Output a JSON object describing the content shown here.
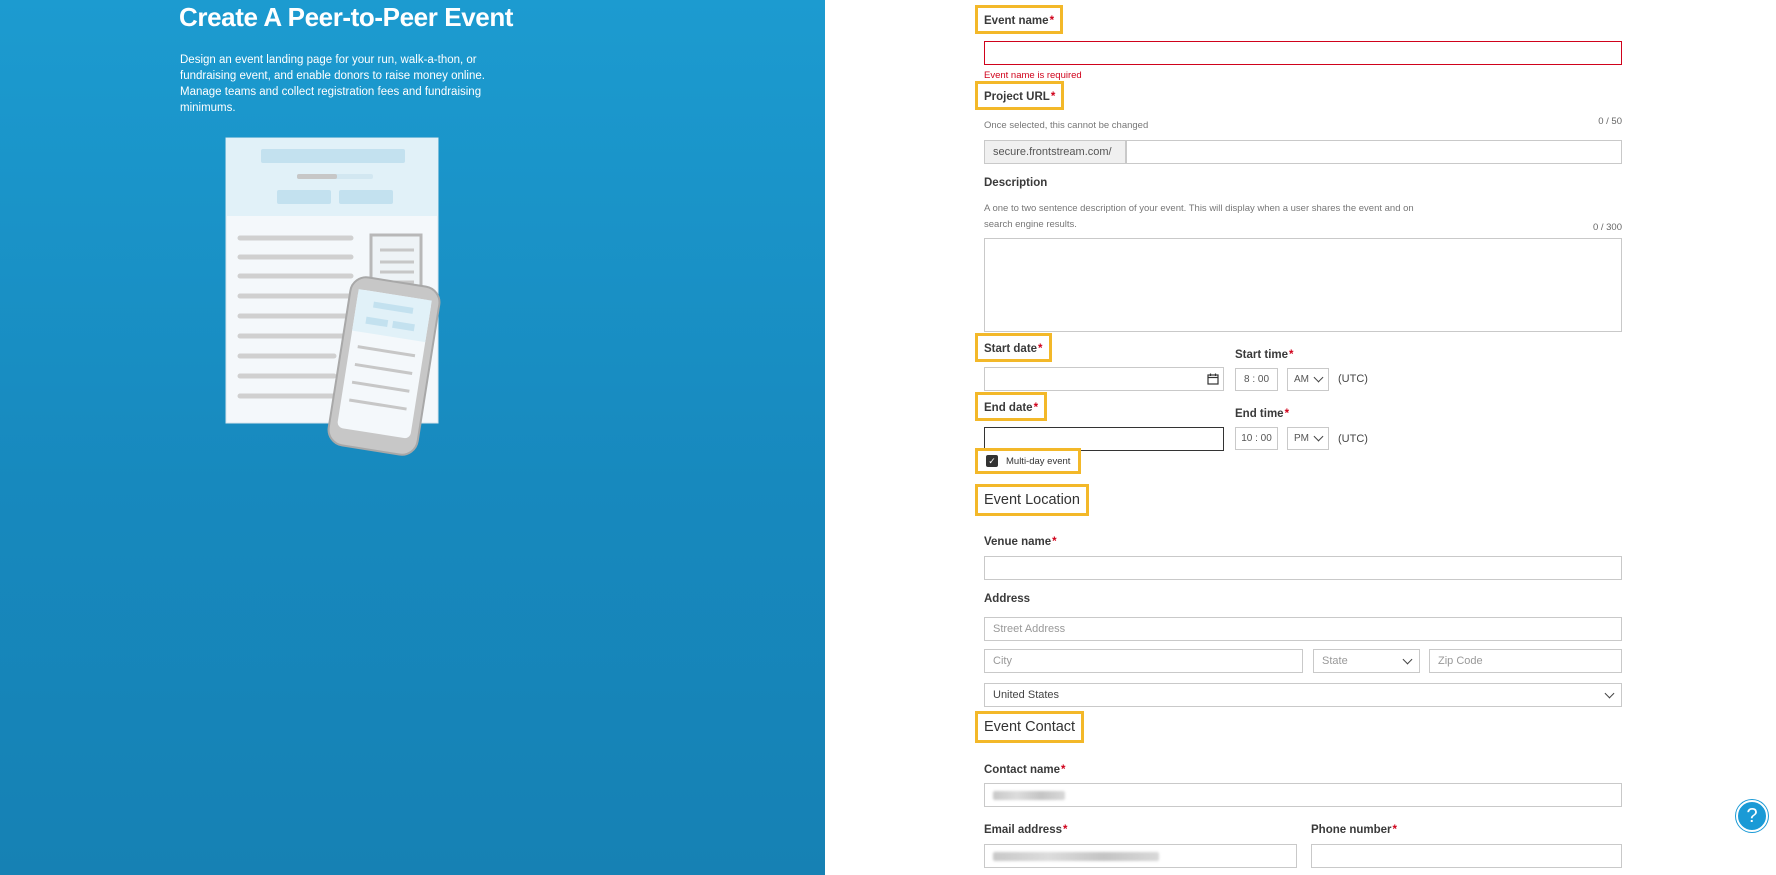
{
  "left": {
    "title": "Create A Peer-to-Peer Event",
    "description": "Design an event landing page for your run, walk-a-thon, or fundraising event, and enable donors to raise money online. Manage teams and collect registration fees and fundraising minimums."
  },
  "form": {
    "event_name": {
      "label": "Event name",
      "required_mark": "*",
      "value": "",
      "error": "Event name is required"
    },
    "project_url": {
      "label": "Project URL",
      "required_mark": "*",
      "hint": "Once selected, this cannot be changed",
      "counter": "0 / 50",
      "prefix": "secure.frontstream.com/",
      "value": ""
    },
    "description": {
      "label": "Description",
      "hint": "A one to two sentence description of your event. This will display when a user shares the event and on search engine results.",
      "counter": "0 / 300",
      "value": ""
    },
    "start_date": {
      "label": "Start date",
      "required_mark": "*",
      "value": ""
    },
    "start_time": {
      "label": "Start time",
      "required_mark": "*",
      "hour": "8",
      "sep": ":",
      "minute": "00",
      "ampm": "AM",
      "tz": "(UTC)"
    },
    "end_date": {
      "label": "End date",
      "required_mark": "*",
      "value": ""
    },
    "end_time": {
      "label": "End time",
      "required_mark": "*",
      "hour": "10",
      "sep": ":",
      "minute": "00",
      "ampm": "PM",
      "tz": "(UTC)"
    },
    "multi_day": {
      "label": "Multi-day event",
      "checked": true
    },
    "event_location": {
      "title": "Event Location",
      "venue_label": "Venue name",
      "required_mark": "*",
      "address_label": "Address",
      "street_placeholder": "Street Address",
      "city_placeholder": "City",
      "state_placeholder": "State",
      "zip_placeholder": "Zip Code",
      "country": "United States"
    },
    "event_contact": {
      "title": "Event Contact",
      "contact_label": "Contact name",
      "email_label": "Email address",
      "phone_label": "Phone number",
      "required_mark": "*"
    }
  },
  "help": {
    "icon": "question-icon",
    "glyph": "?"
  },
  "colors": {
    "panel": "#1789be",
    "highlight": "#f3b829",
    "required": "#d0021b",
    "help": "#1a9ad6"
  }
}
